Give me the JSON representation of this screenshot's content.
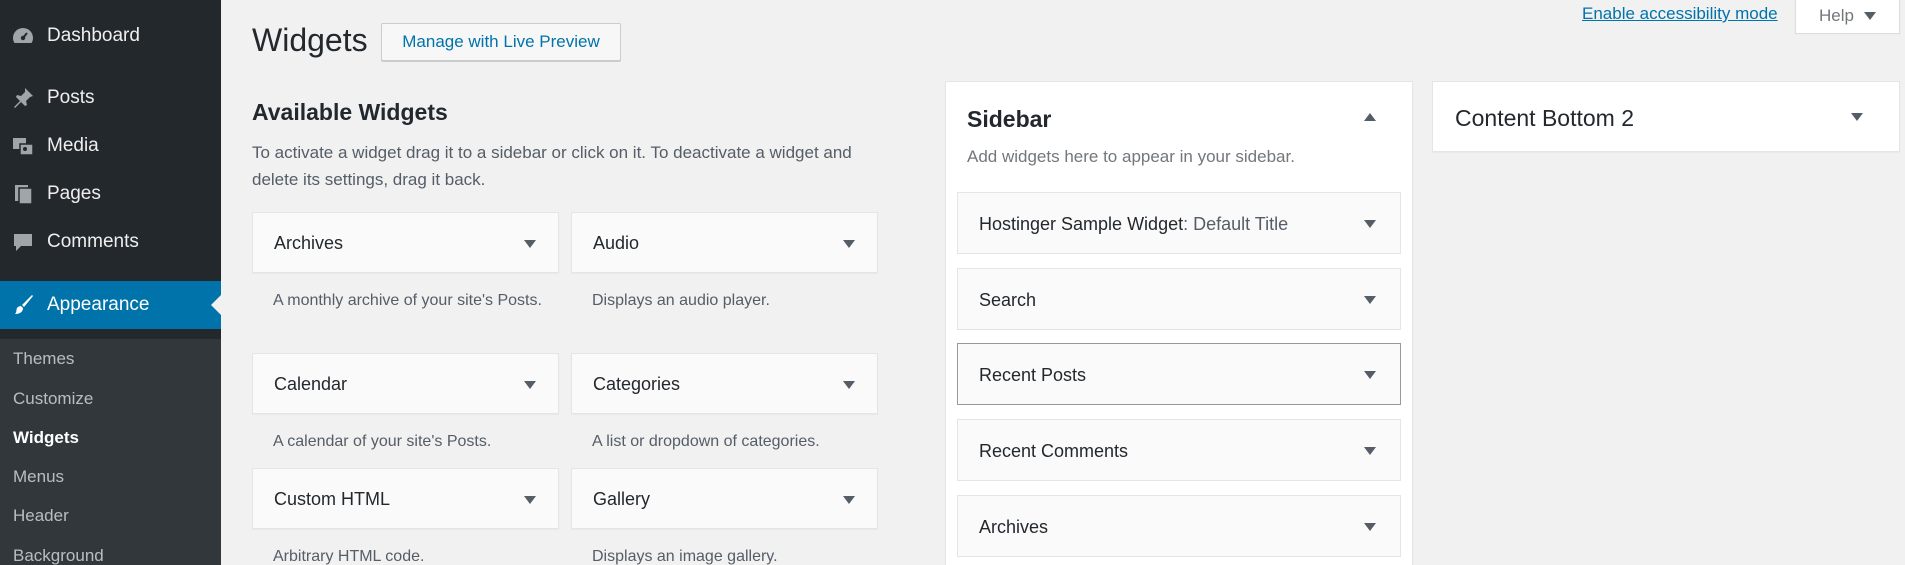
{
  "admin_menu": {
    "items": [
      {
        "label": "Dashboard",
        "icon": "dashboard-icon"
      },
      {
        "label": "Posts",
        "icon": "pin-icon"
      },
      {
        "label": "Media",
        "icon": "media-icon"
      },
      {
        "label": "Pages",
        "icon": "pages-icon"
      },
      {
        "label": "Comments",
        "icon": "comment-icon"
      },
      {
        "label": "Appearance",
        "icon": "brush-icon"
      }
    ],
    "submenu": [
      {
        "label": "Themes"
      },
      {
        "label": "Customize"
      },
      {
        "label": "Widgets"
      },
      {
        "label": "Menus"
      },
      {
        "label": "Header"
      },
      {
        "label": "Background"
      }
    ]
  },
  "top": {
    "accessibility_link": "Enable accessibility mode",
    "help_label": "Help"
  },
  "header": {
    "title": "Widgets",
    "live_preview_button": "Manage with Live Preview"
  },
  "available_widgets": {
    "heading": "Available Widgets",
    "description": "To activate a widget drag it to a sidebar or click on it. To deactivate a widget and delete its settings, drag it back.",
    "widgets": [
      {
        "title": "Archives",
        "description": "A monthly archive of your site's Posts."
      },
      {
        "title": "Audio",
        "description": "Displays an audio player."
      },
      {
        "title": "Calendar",
        "description": "A calendar of your site's Posts."
      },
      {
        "title": "Categories",
        "description": "A list or dropdown of categories."
      },
      {
        "title": "Custom HTML",
        "description": "Arbitrary HTML code."
      },
      {
        "title": "Gallery",
        "description": "Displays an image gallery."
      }
    ]
  },
  "sidebar_area": {
    "title": "Sidebar",
    "description": "Add widgets here to appear in your sidebar.",
    "widgets": [
      {
        "title": "Hostinger Sample Widget",
        "instance_title": ": Default Title"
      },
      {
        "title": "Search",
        "instance_title": ""
      },
      {
        "title": "Recent Posts",
        "instance_title": ""
      },
      {
        "title": "Recent Comments",
        "instance_title": ""
      },
      {
        "title": "Archives",
        "instance_title": ""
      }
    ]
  },
  "content_bottom": {
    "title": "Content Bottom 2"
  },
  "colors": {
    "admin_bg": "#23282d",
    "accent": "#0073aa",
    "page_bg": "#f1f1f1"
  }
}
